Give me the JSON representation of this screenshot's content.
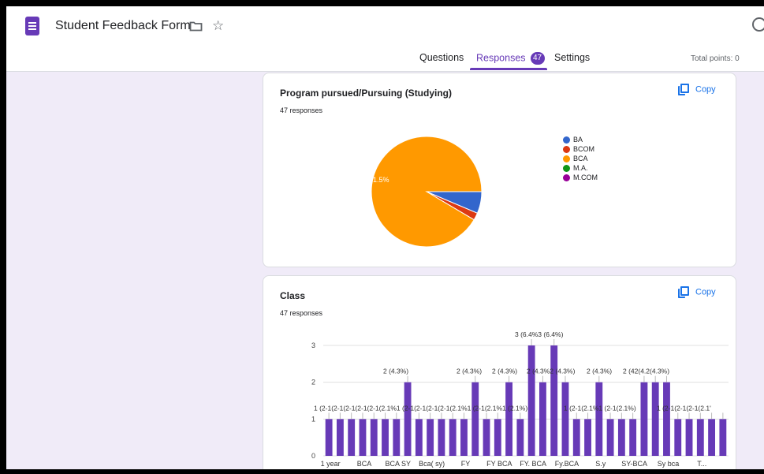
{
  "header": {
    "form_title": "Student Feedback Form",
    "tabs": [
      {
        "label": "Questions"
      },
      {
        "label": "Responses",
        "badge": "47"
      },
      {
        "label": "Settings"
      }
    ],
    "total_points": "Total points: 0"
  },
  "accent_color": "#673ab7",
  "cards": [
    {
      "title": "Program pursued/Pursuing (Studying)",
      "responses": "47 responses",
      "copy_label": "Copy"
    },
    {
      "title": "Class",
      "responses": "47 responses",
      "copy_label": "Copy"
    }
  ],
  "chart_data": [
    {
      "type": "pie",
      "series": [
        {
          "name": "BA",
          "value": 3,
          "color": "#3366cc"
        },
        {
          "name": "BCOM",
          "value": 1,
          "color": "#dc3912"
        },
        {
          "name": "BCA",
          "value": 43,
          "color": "#ff9900"
        },
        {
          "name": "M.A.",
          "value": 0,
          "color": "#109618"
        },
        {
          "name": "M.COM",
          "value": 0,
          "color": "#990099"
        }
      ],
      "slice_labels": [
        {
          "series": "BCA",
          "text": "91.5%"
        }
      ],
      "legend_position": "right"
    },
    {
      "type": "bar",
      "color": "#673ab7",
      "ylim": [
        0,
        3
      ],
      "yticks": [
        "0",
        "1",
        "2",
        "3"
      ],
      "values": [
        1,
        1,
        1,
        1,
        1,
        1,
        1,
        2,
        1,
        1,
        1,
        1,
        1,
        2,
        1,
        1,
        2,
        1,
        3,
        2,
        3,
        2,
        1,
        1,
        2,
        1,
        1,
        1,
        2,
        2,
        2,
        1,
        1,
        1,
        1,
        1
      ],
      "x_tick_labels": [
        "1 year",
        "BCA",
        "BCA SY",
        "Bca( sy)",
        "FY",
        "FY BCA",
        "FY. BCA",
        "Fy.BCA",
        "S.y",
        "SY-BCA",
        "Sy bca",
        "T..."
      ],
      "data_label_rows": [
        "1 (2‑1(2‑1(2‑1(2‑1(2‑1(2.1%1 (2‑1(2‑1(2‑1(2‑1(2.1%1 (2‑1(2.1%1 (2.1%)",
        "2 (4.3%)",
        "2 (4.3%)",
        "2 (4.3%)",
        "2 (4.3%2 (4.3%)",
        "3 (6.4%3 (6.4%)",
        "1 (2‑1(2.1%1 (2‑1(2.1%)",
        "2 (4.3%)",
        "2 (42(4.2(4.3%)",
        "1 (2‑1(2‑1(2‑1(2.1'"
      ],
      "grid": true
    }
  ]
}
